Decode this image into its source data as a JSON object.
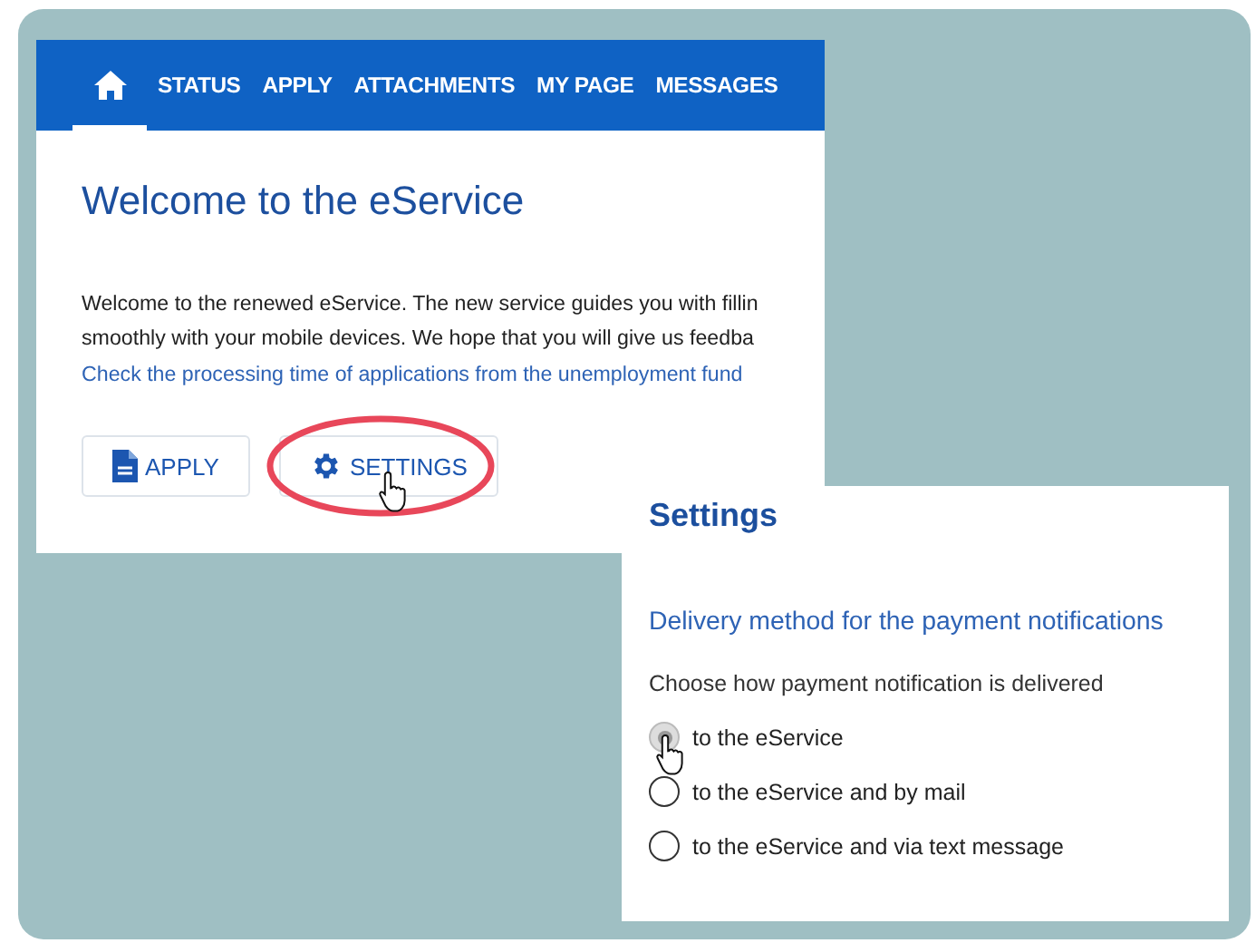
{
  "nav": {
    "items": [
      {
        "kind": "home",
        "selected": true
      },
      {
        "kind": "text",
        "label": "STATUS",
        "selected": false
      },
      {
        "kind": "text",
        "label": "APPLY",
        "selected": false
      },
      {
        "kind": "text",
        "label": "ATTACHMENTS",
        "selected": false
      },
      {
        "kind": "text",
        "label": "MY PAGE",
        "selected": false
      },
      {
        "kind": "text",
        "label": "MESSAGES",
        "selected": false
      }
    ]
  },
  "main": {
    "title": "Welcome to the eService",
    "intro": [
      "Welcome to the renewed eService. The new service guides you with fillin",
      "smoothly with your mobile devices. We hope that you will give us feedba"
    ],
    "link": "Check the processing time of applications from the unemployment fund",
    "buttons": [
      {
        "kind": "document",
        "label": "APPLY",
        "highlighted": false
      },
      {
        "kind": "gear",
        "label": "SETTINGS",
        "highlighted": true
      }
    ]
  },
  "settings": {
    "title": "Settings",
    "section": "Delivery method for the payment notifications",
    "question": "Choose how payment notification is delivered",
    "options": [
      {
        "label": "to the eService",
        "selected": true
      },
      {
        "label": "to the eService and by mail",
        "selected": false
      },
      {
        "label": "to the eService and via text message",
        "selected": false
      }
    ]
  }
}
